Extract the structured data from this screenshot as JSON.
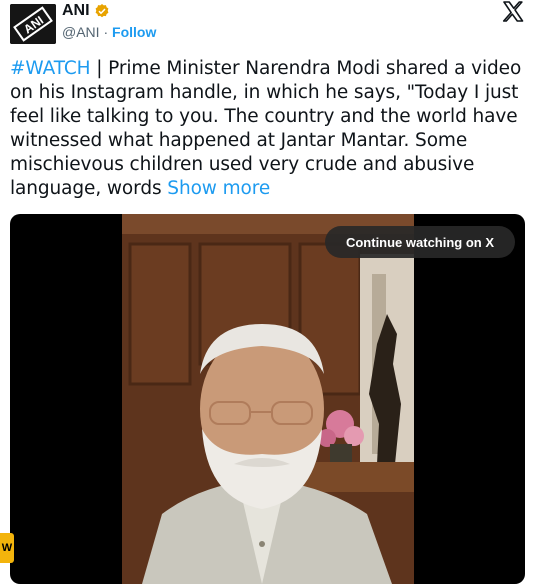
{
  "author": {
    "name": "ANI",
    "handle": "@ANI",
    "separator": "·",
    "follow_label": "Follow",
    "avatar_text": "ANI"
  },
  "tweet": {
    "hashtag": "#WATCH",
    "body": " | Prime Minister Narendra Modi shared a video on his Instagram handle, in which he says, \"Today I just feel like talking to you. The country and the world have witnessed what happened at Jantar Mantar. Some mischievous children used very crude and abusive language, words ",
    "show_more": "Show more"
  },
  "video": {
    "continue_label": "Continue watching on X"
  },
  "side_badge": "W",
  "colors": {
    "accent": "#1d9bf0",
    "verified": "#e8a300"
  }
}
